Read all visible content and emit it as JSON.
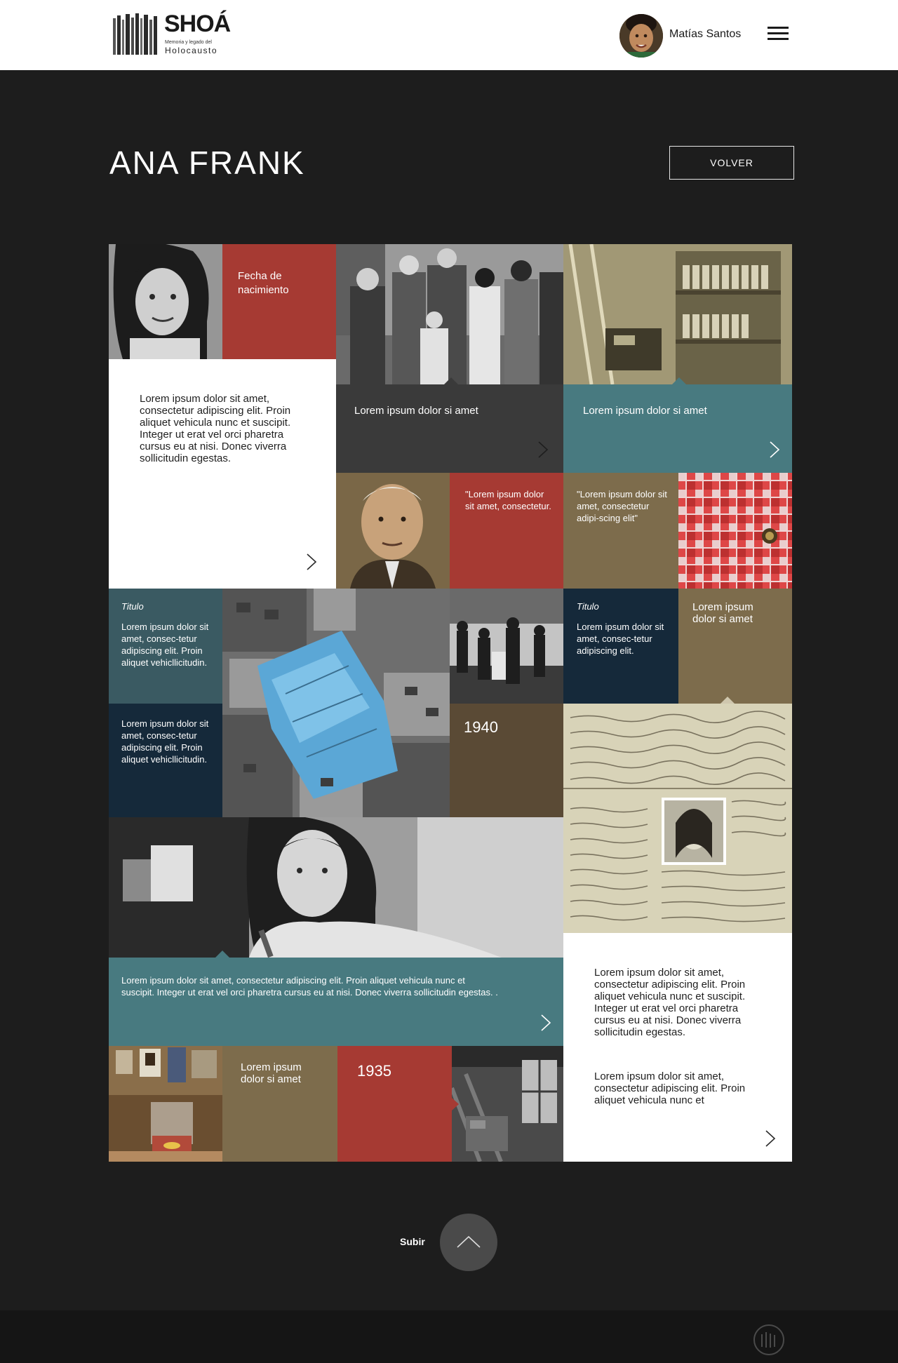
{
  "header": {
    "logo_title": "SHOÁ",
    "logo_subtitle": "Memoria y legado del",
    "logo_tagline": "Holocausto",
    "user_name": "Matías Santos"
  },
  "page": {
    "title": "ANA FRANK",
    "back_label": "VOLVER"
  },
  "tiles": {
    "birth_label": "Fecha de nacimiento",
    "intro_text": "Lorem ipsum dolor sit amet, consectetur adipiscing elit. Proin aliquet vehicula nunc et suscipit. Integer ut erat vel orci pharetra cursus eu at nisi. Donec viverra sollicitudin egestas.",
    "family_caption": "Lorem ipsum dolor si amet",
    "annex_caption": "Lorem ipsum dolor si amet",
    "otto_quote": "\"Lorem ipsum dolor sit amet, consectetur.",
    "diary_quote": "\"Lorem ipsum dolor sit amet, consectetur adipi-scing elit\"",
    "titulo_label": "Titulo",
    "teal_body": "Lorem ipsum dolor sit amet, consec-tetur adipiscing elit. Proin aliquet vehicllicitudin.",
    "navy_body": "Lorem ipsum dolor sit amet, consec-tetur adipiscing elit. Proin aliquet vehicllicitudin.",
    "titulo2_label": "Titulo",
    "titulo2_body": "Lorem ipsum dolor sit amet, consec-tetur adipiscing elit.",
    "olive_caption": "Lorem ipsum dolor si amet",
    "year_1940": "1940",
    "writing_text": "Lorem ipsum dolor sit amet, consectetur adipiscing elit. Proin aliquet vehicula nunc et suscipit. Integer ut erat vel orci pharetra cursus eu at nisi. Donec viverra sollicitudin egestas. .",
    "side_text_1": "Lorem ipsum dolor sit amet, consectetur adipiscing elit. Proin aliquet vehicula nunc et suscipit. Integer ut erat vel orci pharetra cursus eu at nisi. Donec viverra sollicitudin egestas.",
    "side_text_2": "Lorem ipsum dolor sit amet, consectetur adipiscing elit. Proin aliquet vehicula nunc et",
    "museum_caption": "Lorem ipsum dolor si amet",
    "year_1935": "1935"
  },
  "footer": {
    "scroll_top_label": "Subir"
  },
  "colors": {
    "red": "#a63a33",
    "teal": "#487a80",
    "olive": "#7d6c4c",
    "navy": "#15293a",
    "dark": "#3a3a3a",
    "background": "#1d1d1d"
  }
}
